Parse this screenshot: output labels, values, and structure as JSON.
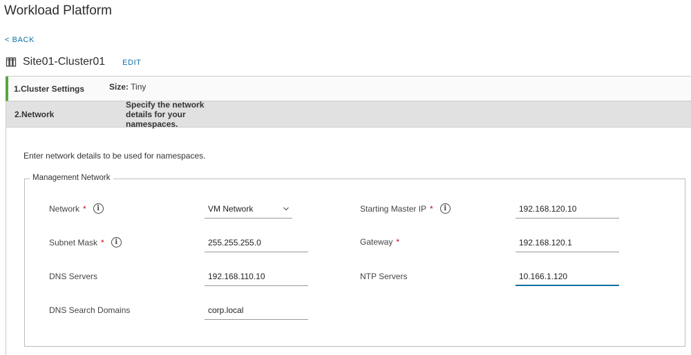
{
  "header": {
    "title": "Workload Platform",
    "back_label": "< BACK",
    "cluster_name": "Site01-Cluster01",
    "edit_label": "EDIT"
  },
  "steps": [
    {
      "title": "1.Cluster Settings",
      "desc_key": "Size:",
      "desc_value": "Tiny",
      "status": "complete"
    },
    {
      "title": "2.Network",
      "desc": "Specify the network details for your namespaces.",
      "status": "active"
    }
  ],
  "network": {
    "intro": "Enter network details to be used for namespaces.",
    "fieldset_legend": "Management Network",
    "fields": {
      "network": {
        "label": "Network",
        "value": "VM Network",
        "required": true,
        "info": true
      },
      "starting_master_ip": {
        "label": "Starting Master IP",
        "value": "192.168.120.10",
        "required": true,
        "info": true
      },
      "subnet_mask": {
        "label": "Subnet Mask",
        "value": "255.255.255.0",
        "required": true,
        "info": true
      },
      "gateway": {
        "label": "Gateway",
        "value": "192.168.120.1",
        "required": true
      },
      "dns_servers": {
        "label": "DNS Servers",
        "value": "192.168.110.10"
      },
      "ntp_servers": {
        "label": "NTP Servers",
        "value": "10.166.1.120",
        "focused": true
      },
      "dns_search_domains": {
        "label": "DNS Search Domains",
        "value": "corp.local"
      }
    },
    "required_marker": "*",
    "info_glyph": "i"
  },
  "colors": {
    "link": "#0b6fa4",
    "complete": "#5aa63f",
    "required": "#d0021b",
    "active_step_bg": "#e1e1e1"
  },
  "icons": {
    "cluster": "cluster-icon",
    "info": "info-icon",
    "dropdown": "chevron-down-icon"
  }
}
